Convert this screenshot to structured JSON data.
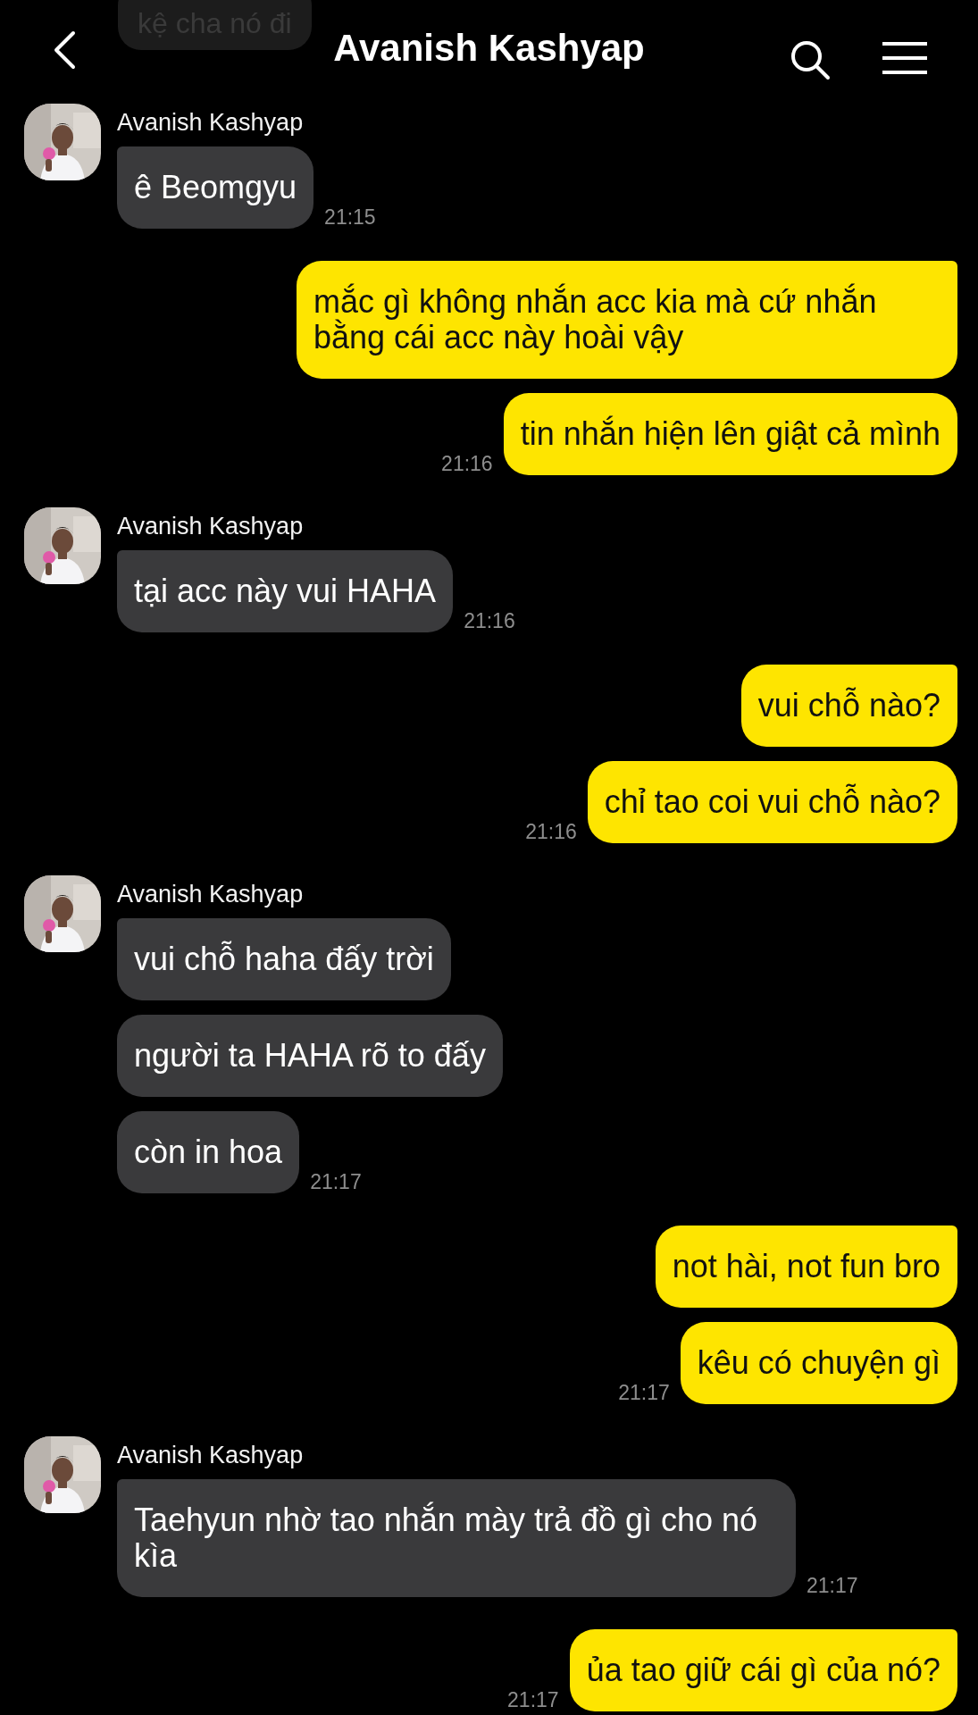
{
  "header": {
    "title": "Avanish Kashyap",
    "faded_message": "kệ cha nó đi"
  },
  "groups": [
    {
      "kind": "received",
      "name": "Avanish Kashyap",
      "avatar": {
        "kind": "picture"
      },
      "messages": [
        {
          "text": "ê Beomgyu",
          "time": "21:15"
        }
      ]
    },
    {
      "kind": "sent",
      "messages": [
        {
          "text": "mắc gì không nhắn acc kia mà cứ nhắn bằng cái acc này hoài vậy"
        },
        {
          "text": "tin nhắn hiện lên giật cả mình",
          "time": "21:16"
        }
      ]
    },
    {
      "kind": "received",
      "name": "Avanish Kashyap",
      "avatar": {
        "kind": "picture"
      },
      "messages": [
        {
          "text": "tại acc này vui HAHA",
          "time": "21:16"
        }
      ]
    },
    {
      "kind": "sent",
      "messages": [
        {
          "text": "vui chỗ nào?"
        },
        {
          "text": "chỉ tao coi vui chỗ nào?",
          "time": "21:16"
        }
      ]
    },
    {
      "kind": "received",
      "name": "Avanish Kashyap",
      "avatar": {
        "kind": "picture"
      },
      "messages": [
        {
          "text": "vui chỗ haha đấy trời"
        },
        {
          "text": "người ta HAHA rõ to đấy"
        },
        {
          "text": "còn in hoa",
          "time": "21:17"
        }
      ]
    },
    {
      "kind": "sent",
      "messages": [
        {
          "text": "not hài, not fun bro"
        },
        {
          "text": "kêu có chuyện gì",
          "time": "21:17"
        }
      ]
    },
    {
      "kind": "received",
      "name": "Avanish Kashyap",
      "avatar": {
        "kind": "picture"
      },
      "messages": [
        {
          "text": "Taehyun nhờ tao nhắn mày trả đồ gì cho nó kìa",
          "time": "21:17"
        }
      ]
    },
    {
      "kind": "sent",
      "messages": [
        {
          "text": "ủa tao giữ cái gì của nó?",
          "time": "21:17"
        }
      ]
    }
  ]
}
